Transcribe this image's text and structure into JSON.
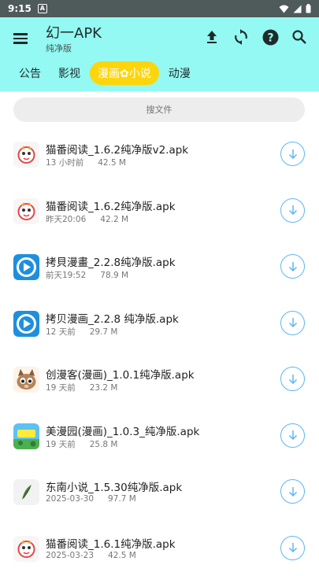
{
  "status_bar": {
    "time": "9:15",
    "notification_letter": "A"
  },
  "header": {
    "title": "幻一APK",
    "subtitle": "纯净版"
  },
  "actions": [
    {
      "name": "upload-icon"
    },
    {
      "name": "refresh-icon"
    },
    {
      "name": "help-icon"
    },
    {
      "name": "search-icon"
    }
  ],
  "tabs": [
    {
      "label": "公告",
      "active": false
    },
    {
      "label": "影视",
      "active": false
    },
    {
      "label": "漫画✿小说",
      "active": true
    },
    {
      "label": "动漫",
      "active": false
    }
  ],
  "colors": {
    "header_bg": "#93f9f2",
    "active_tab": "#fcd50c",
    "download_accent": "#5bb6f5"
  },
  "search": {
    "placeholder": "搜文件"
  },
  "files": [
    {
      "name": "猫番阅读_1.6.2纯净版v2.apk",
      "time": "13 小时前",
      "size": "42.5 M",
      "icon": "maofan-icon"
    },
    {
      "name": "猫番阅读_1.6.2纯净版.apk",
      "time": "昨天20:06",
      "size": "42.2 M",
      "icon": "maofan-icon"
    },
    {
      "name": "拷貝漫畫_2.2.8纯净版.apk",
      "time": "前天19:52",
      "size": "78.9 M",
      "icon": "kaobei-icon"
    },
    {
      "name": "拷贝漫画_2.2.8 纯净版.apk",
      "time": "12 天前",
      "size": "29.7 M",
      "icon": "kaobei-icon"
    },
    {
      "name": "创漫客(漫画)_1.0.1纯净版.apk",
      "time": "19 天前",
      "size": "23.2 M",
      "icon": "chuangmanke-icon"
    },
    {
      "name": "美漫园(漫画)_1.0.3_纯净版.apk",
      "time": "19 天前",
      "size": "25.8 M",
      "icon": "meimanyuan-icon"
    },
    {
      "name": "东南小说_1.5.30纯净版.apk",
      "time": "2025-03-30",
      "size": "97.7 M",
      "icon": "dongnan-icon"
    },
    {
      "name": "猫番阅读_1.6.1纯净版.apk",
      "time": "2025-03-23",
      "size": "42.5 M",
      "icon": "maofan-icon"
    }
  ]
}
